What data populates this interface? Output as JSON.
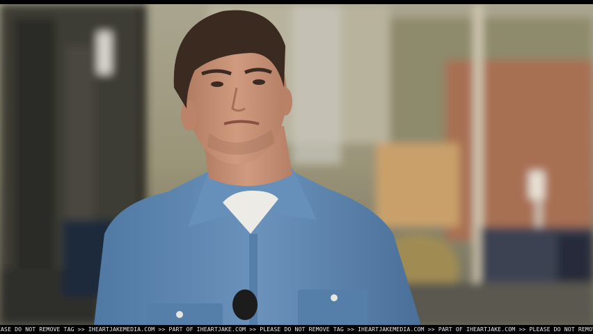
{
  "image": {
    "subject": "man-in-denim-shirt",
    "setting": "outdoor-street",
    "colors": {
      "shirt": "#5f88b2",
      "shirt_shadow": "#3f6187",
      "skin": "#c99378",
      "hair": "#3a2a20",
      "background_warm": "#a98e6a",
      "strip": "#000000"
    }
  },
  "watermark": {
    "text": "EASE DO NOT REMOVE TAG >> IHEARTJAKEMEDIA.COM >> PART OF IHEARTJAKE.COM >> PLEASE DO NOT REMOVE TAG >> IHEARTJAKEMEDIA.COM >> PART OF IHEARTJAKE.COM >> PLEASE DO NOT REMOVE TAG >> IHEARTJAKEMEDIA.COM >> PART OF IHEARTJAKE.COM >> PLEASE DO NOT REMOVE TAG >> IHEARTJAKEMEDIA.COM >> PART OF IHEARTJAKE.COM >> PLEASE DO NOT REMOVE TAG >> IHEARTJAKEMEDIA.COM >> PART OF IHEARTJAKE.COM >> PLEASE DO NOT REMOVE TAG >> IHEARTJ"
  }
}
